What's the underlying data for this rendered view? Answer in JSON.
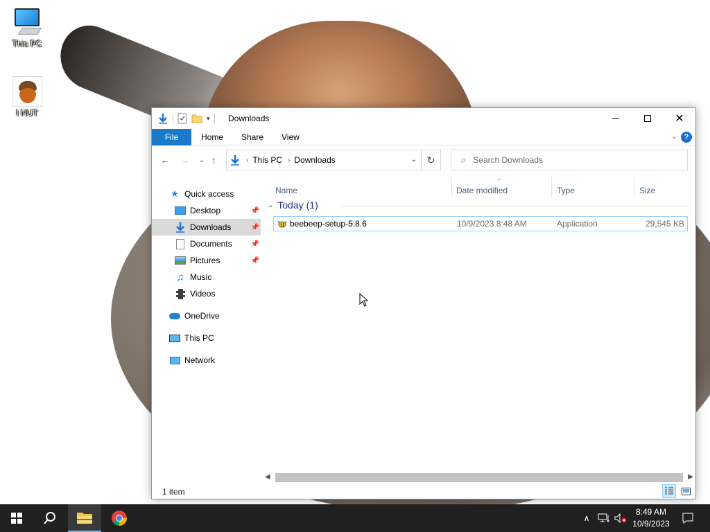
{
  "desktop": {
    "icons": [
      {
        "label": "This PC",
        "icon": "computer-icon"
      },
      {
        "label": "I NUT",
        "icon": "acorn-icon"
      }
    ]
  },
  "window": {
    "title": "Downloads",
    "controls": {
      "minimize": "minimize-icon",
      "maximize": "maximize-icon",
      "close": "close-icon"
    },
    "ribbon": {
      "tabs": [
        "File",
        "Home",
        "Share",
        "View"
      ],
      "help": "?"
    },
    "address": {
      "segments": [
        "This PC",
        "Downloads"
      ]
    },
    "search": {
      "placeholder": "Search Downloads"
    },
    "nav_pane": {
      "quick_access": "Quick access",
      "pinned": [
        {
          "label": "Desktop",
          "pinned": true
        },
        {
          "label": "Downloads",
          "pinned": true,
          "selected": true
        },
        {
          "label": "Documents",
          "pinned": true
        },
        {
          "label": "Pictures",
          "pinned": true
        },
        {
          "label": "Music",
          "pinned": false
        },
        {
          "label": "Videos",
          "pinned": false
        }
      ],
      "roots": [
        "OneDrive",
        "This PC",
        "Network"
      ]
    },
    "columns": [
      "Name",
      "Date modified",
      "Type",
      "Size"
    ],
    "group": {
      "label": "Today (1)"
    },
    "files": [
      {
        "name": "beebeep-setup-5.8.6",
        "date": "10/9/2023 8:48 AM",
        "type": "Application",
        "size": "29,545 KB"
      }
    ],
    "status": {
      "count": "1 item"
    }
  },
  "taskbar": {
    "apps": [
      "start-icon",
      "search-icon",
      "file-explorer-icon",
      "chrome-icon"
    ],
    "clock": {
      "time": "8:49 AM",
      "date": "10/9/2023"
    }
  },
  "colors": {
    "accent": "#1979ca",
    "selection": "#cce8ff",
    "taskbar": "#202020"
  }
}
